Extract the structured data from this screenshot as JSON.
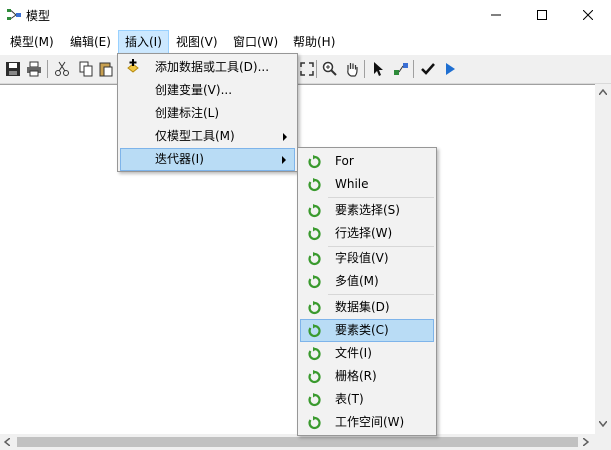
{
  "window": {
    "title": "模型"
  },
  "menubar": {
    "items": [
      {
        "label": "模型(M)"
      },
      {
        "label": "编辑(E)"
      },
      {
        "label": "插入(I)"
      },
      {
        "label": "视图(V)"
      },
      {
        "label": "窗口(W)"
      },
      {
        "label": "帮助(H)"
      }
    ]
  },
  "insert_menu": {
    "items": [
      {
        "label": "添加数据或工具(D)...",
        "icon": "add-data-icon"
      },
      {
        "label": "创建变量(V)..."
      },
      {
        "label": "创建标注(L)"
      },
      {
        "label": "仅模型工具(M)",
        "submenu": true
      },
      {
        "label": "迭代器(I)",
        "submenu": true,
        "highlighted": true
      }
    ]
  },
  "iterator_menu": {
    "items": [
      {
        "label": "For",
        "icon": "iterator-icon"
      },
      {
        "label": "While",
        "icon": "iterator-icon"
      },
      {
        "label": "要素选择(S)",
        "icon": "iterator-icon"
      },
      {
        "label": "行选择(W)",
        "icon": "iterator-icon"
      },
      {
        "label": "字段值(V)",
        "icon": "iterator-icon"
      },
      {
        "label": "多值(M)",
        "icon": "iterator-icon"
      },
      {
        "label": "数据集(D)",
        "icon": "iterator-icon"
      },
      {
        "label": "要素类(C)",
        "icon": "iterator-icon",
        "highlighted": true
      },
      {
        "label": "文件(I)",
        "icon": "iterator-icon"
      },
      {
        "label": "栅格(R)",
        "icon": "iterator-icon"
      },
      {
        "label": "表(T)",
        "icon": "iterator-icon"
      },
      {
        "label": "工作空间(W)",
        "icon": "iterator-icon"
      }
    ]
  },
  "colors": {
    "highlight": "#b9dcf5",
    "iterator_green": "#3a9a2e",
    "run_blue": "#1f6fd1"
  }
}
